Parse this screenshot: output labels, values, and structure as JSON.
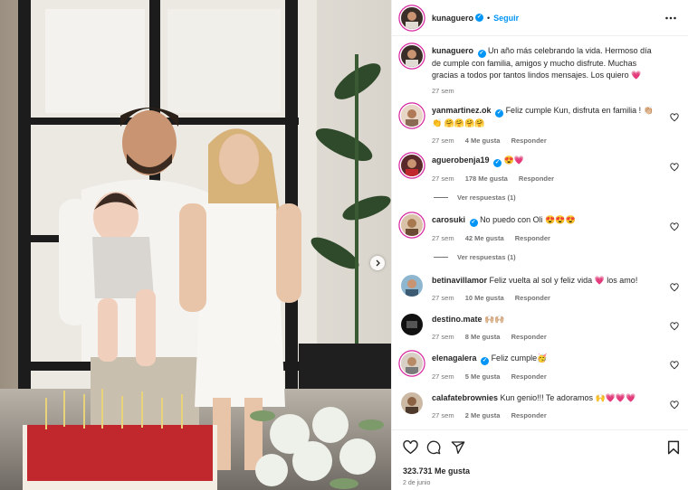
{
  "post": {
    "username": "kunaguero",
    "follow_label": "Seguir",
    "separator": "•"
  },
  "caption": {
    "username": "kunaguero",
    "text": "Un año más celebrando la vida. Hermoso día de cumple con familia, amigos y mucho disfrute. Muchas gracias a todos por tantos lindos mensajes. Los quiero 💗",
    "time": "27 sem"
  },
  "comments": [
    {
      "username": "yanmartinez.ok",
      "verified": true,
      "text": "Feliz cumple Kun, disfruta en familia ! 👏🏼👏 🤗🤗🤗🤗",
      "time": "27 sem",
      "likes": "4 Me gusta",
      "reply": "Responder"
    },
    {
      "username": "aguerobenja19",
      "verified": true,
      "text": "😍💗",
      "time": "27 sem",
      "likes": "178 Me gusta",
      "reply": "Responder",
      "view_replies": "Ver respuestas (1)"
    },
    {
      "username": "carosuki",
      "verified": true,
      "text": "No puedo con Oli 😍😍😍",
      "time": "27 sem",
      "likes": "42 Me gusta",
      "reply": "Responder",
      "view_replies": "Ver respuestas (1)"
    },
    {
      "username": "betinavillamor",
      "verified": false,
      "text": "Feliz vuelta al sol y feliz vida 💗 los amo!",
      "time": "27 sem",
      "likes": "10 Me gusta",
      "reply": "Responder"
    },
    {
      "username": "destino.mate",
      "verified": false,
      "text": "🙌🏼🙌🏼",
      "time": "27 sem",
      "likes": "8 Me gusta",
      "reply": "Responder"
    },
    {
      "username": "elenagalera",
      "verified": true,
      "text": "Feliz cumple🥳",
      "time": "27 sem",
      "likes": "5 Me gusta",
      "reply": "Responder"
    },
    {
      "username": "calafatebrownies",
      "verified": false,
      "text": "Kun genio!!! Te adoramos 🙌💗💗💗",
      "time": "27 sem",
      "likes": "2 Me gusta",
      "reply": "Responder"
    }
  ],
  "footer": {
    "likes": "323.731 Me gusta",
    "date": "2 de junio"
  },
  "icons": {
    "header_more": "more-horizontal-icon",
    "comment_like": "heart-outline-icon",
    "like": "heart-icon",
    "comment": "comment-icon",
    "share": "send-icon",
    "save": "bookmark-icon",
    "next": "chevron-right-icon"
  },
  "colors": {
    "accent": "#0095f6",
    "secondary_text": "#737373",
    "story_ring": "#d6249f"
  }
}
